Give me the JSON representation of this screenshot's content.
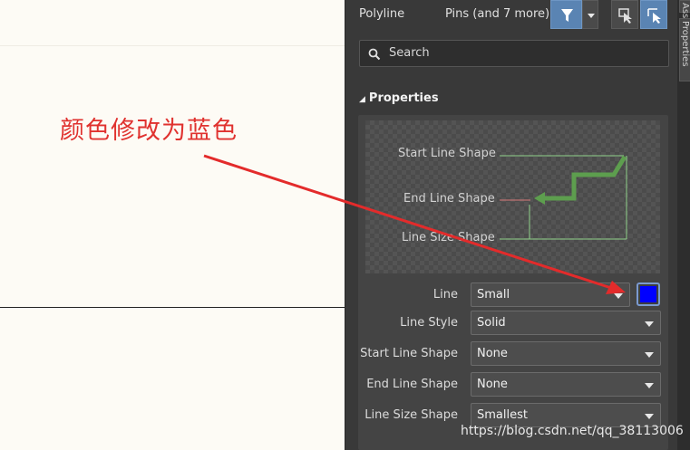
{
  "annotation": {
    "text": "颜色修改为蓝色",
    "color": "#e0322f"
  },
  "header": {
    "object_label": "Polyline",
    "filter_label": "Pins (and 7 more)"
  },
  "side_tabs": [
    {
      "label": "Ass"
    },
    {
      "label": "Properties"
    }
  ],
  "search": {
    "placeholder": "Search"
  },
  "section": {
    "title": "Properties"
  },
  "preview": {
    "start_label": "Start Line Shape",
    "end_label": "End Line Shape",
    "size_label": "Line Size Shape"
  },
  "properties": {
    "line": {
      "label": "Line",
      "value": "Small",
      "color": "#0000ff"
    },
    "line_style": {
      "label": "Line Style",
      "value": "Solid"
    },
    "start_shape": {
      "label": "Start Line Shape",
      "value": "None"
    },
    "end_shape": {
      "label": "End Line Shape",
      "value": "None"
    },
    "size_shape": {
      "label": "Line Size Shape",
      "value": "Smallest"
    }
  },
  "watermark": "https://blog.csdn.net/qq_38113006",
  "colors": {
    "accent": "#5a84b3",
    "panel": "#393939",
    "arrow": "#e32b2b"
  }
}
